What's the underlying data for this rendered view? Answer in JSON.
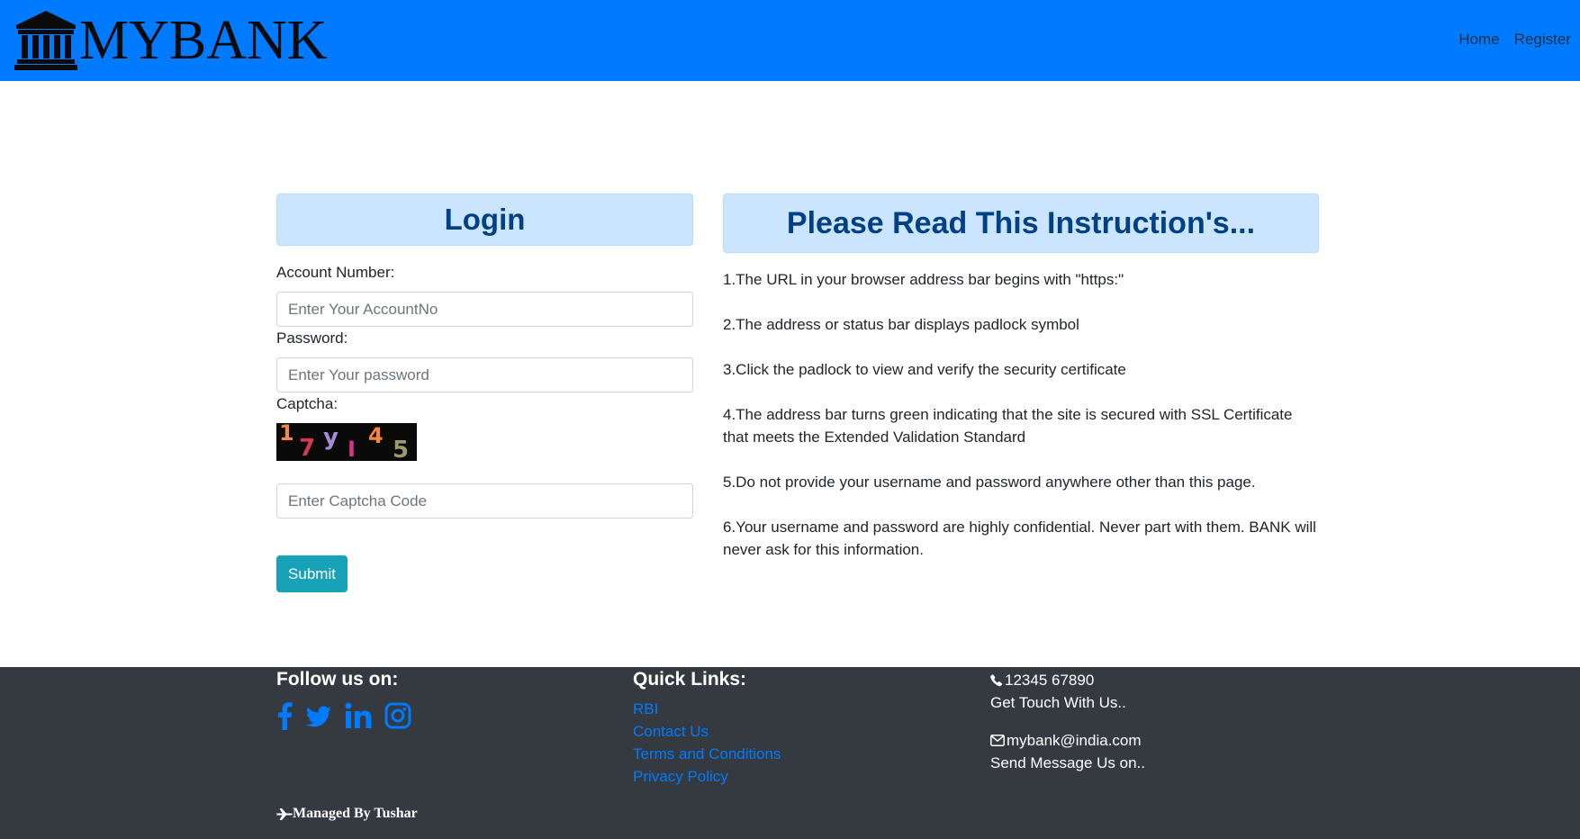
{
  "header": {
    "brand": "MYBANK",
    "brand_icon": "bank-icon",
    "nav": [
      "Home",
      "Register"
    ],
    "background": "#007bff"
  },
  "login": {
    "title": "Login",
    "account_label": "Account Number:",
    "account_placeholder": "Enter Your AccountNo",
    "account_value": "",
    "password_label": "Password:",
    "password_placeholder": "Enter Your password",
    "password_value": "",
    "captcha_label": "Captcha:",
    "captcha_chars": [
      "1",
      "7",
      "y",
      "I",
      "4",
      "5"
    ],
    "captcha_colors": [
      "#f08a4b",
      "#d9364f",
      "#a58bd8",
      "#d63384",
      "#f0883e",
      "#9a9a6a"
    ],
    "captcha_placeholder": "Enter Captcha Code",
    "captcha_value": "",
    "submit_label": "Submit",
    "submit_color": "#17a2b8"
  },
  "instructions": {
    "title": "Please Read This Instruction's...",
    "items": [
      "1.The URL in your browser address bar begins with \"https:\"",
      "2.The address or status bar displays padlock symbol",
      "3.Click the padlock to view and verify the security certificate",
      "4.The address bar turns green indicating that the site is secured with SSL Certificate that meets the Extended Validation Standard",
      "5.Do not provide your username and password anywhere other than this page.",
      "6.Your username and password are highly confidential. Never part with them. BANK will never ask for this information."
    ]
  },
  "footer": {
    "follow_heading": "Follow us on:",
    "social_icons": [
      "facebook-icon",
      "twitter-icon",
      "linkedin-icon",
      "instagram-icon"
    ],
    "quick_heading": "Quick Links:",
    "quick_links": [
      "RBI",
      "Contact Us",
      "Terms and Conditions",
      "Privacy Policy"
    ],
    "phone": "12345 67890",
    "phone_caption": "Get Touch With Us..",
    "email": "mybank@india.com",
    "email_caption": "Send Message Us on..",
    "managed_by": "Managed By Tushar",
    "background": "#343a40",
    "link_color": "#007bff"
  }
}
